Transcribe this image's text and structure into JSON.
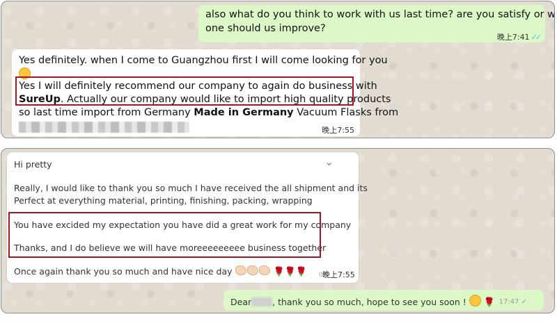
{
  "panel1": {
    "outgoing": {
      "line1": "also what do you think to work with us last time? are you satisfy or which",
      "line2": "one should us improve?",
      "time": "晚上7:41",
      "ticks": "✓✓"
    },
    "incoming": {
      "line1": "Yes definitely. when I come to Guangzhou first I will come looking for you",
      "line1_end": ".",
      "line2": "Yes I will definitely recommend our company to again do business with",
      "line3_bold": "SureUp",
      "line3": ". Actually our company would like to import high quality products",
      "line4_a": "so last time import from Germany ",
      "line4_bold": "Made in Germany",
      "line4_b": " Vacuum Flasks from",
      "time": "晚上7:55"
    }
  },
  "panel2": {
    "incoming": {
      "greeting": "Hi pretty",
      "chevron": "⌄",
      "p1_line1": "Really, I would like to thank you so much I have received the all shipment and its",
      "p1_line2": "Perfect at everything material, printing, finishing, packing, wrapping",
      "p2_line1": "You have excided my expectation you have did a great work for my company",
      "p3_line1": "Thanks, and I do believe we will have moreeeeeeeee business together",
      "p4_line1": "Once again thank you so much and have nice day",
      "roses": "🌹🌹🌹",
      "time": "晚上7:55",
      "time_faint": "09"
    },
    "outgoing": {
      "text_a": "Dear",
      "text_b": ", thank you so much, hope to see you soon !",
      "rose": "🌹",
      "time": "17:47",
      "tick": "✓"
    }
  },
  "colors": {
    "outgoing_bubble": "#dcf8c6",
    "incoming_bubble": "#ffffff",
    "highlight_box": "#a31521",
    "wallpaper": "#e2dbd2",
    "read_ticks": "#53bdeb"
  }
}
